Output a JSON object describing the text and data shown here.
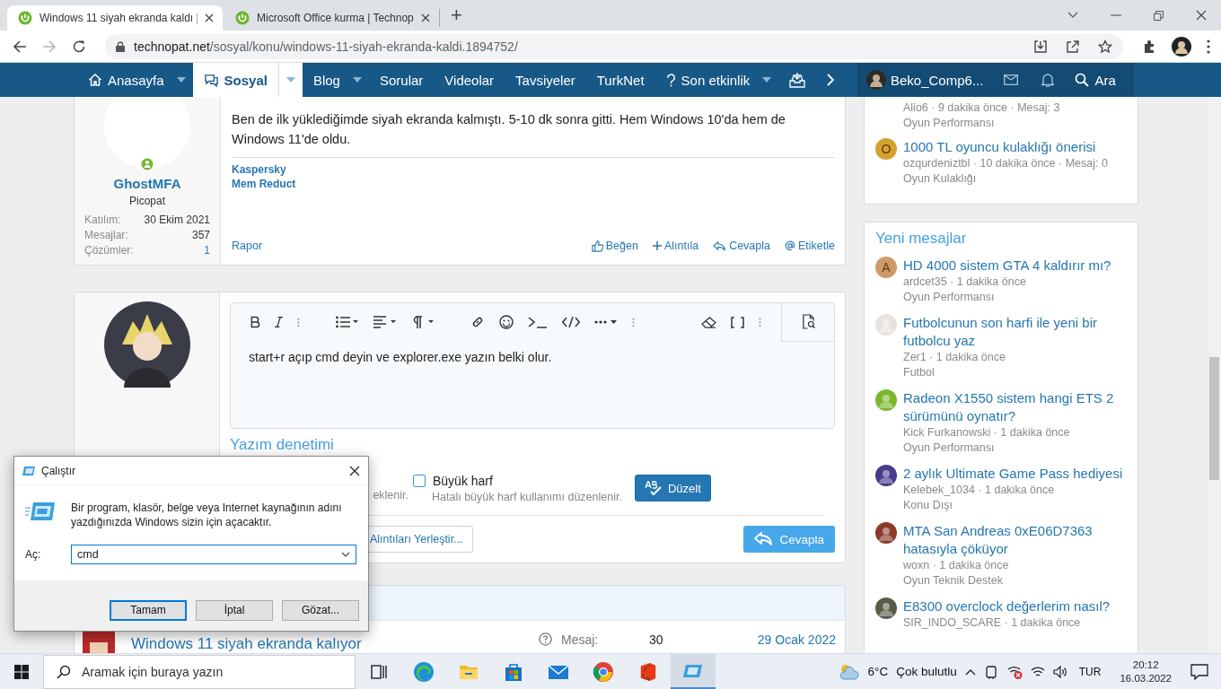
{
  "browser": {
    "tabs": [
      {
        "title": "Windows 11 siyah ekranda kaldı |",
        "selected": true
      },
      {
        "title": "Microsoft Office kurma | Technop",
        "selected": false
      }
    ],
    "new_tab": "+",
    "forward_disabled": true,
    "address": {
      "domain": "technopat.net",
      "path": "/sosyal/konu/windows-11-siyah-ekranda-kaldi.1894752/"
    }
  },
  "nav": {
    "items": [
      {
        "label": "Anasayfa",
        "dropdown": true,
        "selected": false
      },
      {
        "label": "Sosyal",
        "dropdown": true,
        "selected": true
      },
      {
        "label": "Blog",
        "dropdown": true,
        "selected": false
      },
      {
        "label": "Sorular",
        "dropdown": false,
        "selected": false
      },
      {
        "label": "Videolar",
        "dropdown": false,
        "selected": false
      },
      {
        "label": "Tavsiyeler",
        "dropdown": false,
        "selected": false
      },
      {
        "label": "TurkNet",
        "dropdown": false,
        "selected": false
      },
      {
        "label": "Son etkinlik",
        "dropdown": true,
        "selected": false
      }
    ],
    "user": "Beko_Comp6...",
    "search": "Ara"
  },
  "post": {
    "author": {
      "name": "GhostMFA",
      "online": true,
      "title": "Picopat",
      "stats": [
        {
          "label": "Katılım:",
          "value": "30 Ekim 2021"
        },
        {
          "label": "Mesajlar:",
          "value": "357"
        },
        {
          "label": "Çözümler:",
          "value": "1"
        }
      ]
    },
    "text": "Ben de ilk yüklediğimde siyah ekranda kalmıştı. 5-10 dk sonra gitti. Hem Windows 10'da hem de Windows 11'de oldu.",
    "signature": [
      "Kaspersky",
      "Mem Reduct"
    ],
    "report": "Rapor",
    "actions": [
      "Beğen",
      "Alıntıla",
      "Cevapla",
      "Etiketle"
    ]
  },
  "reply": {
    "text": "start+r açıp cmd deyin ve explorer.exe yazın belki olur.",
    "spellcheck": {
      "title": "Yazım denetimi",
      "options": [
        {
          "description": "eklenir."
        },
        {
          "label": "Büyük harf",
          "checked": false,
          "description": "Hatalı büyük harf kullanımı düzenlenir."
        }
      ],
      "fix_button": "Düzelt"
    },
    "insert_quotes": "Alıntıları Yerleştir...",
    "submit": "Cevapla"
  },
  "thread_row": {
    "title": "Windows 11 siyah ekranda kalıyor",
    "label": "Mesaj:",
    "count": "30",
    "date": "29 Ocak 2022"
  },
  "sidebar": {
    "top_items": [
      {
        "meta": "Alio6 · 9 dakika önce · Mesaj: 3",
        "category": "Oyun Performansı"
      },
      {
        "title": "1000 TL oyuncu kulaklığı önerisi",
        "meta": "ozqurdeniztbl · 10 dakika önce · Mesaj: 0",
        "category": "Oyun Kulaklığı",
        "avatar": {
          "kind": "letter",
          "letter": "O",
          "color": "#d4a22f"
        }
      }
    ],
    "new_messages": {
      "title": "Yeni mesajlar",
      "items": [
        {
          "title": "HD 4000 sistem GTA 4 kaldırır mı?",
          "meta": "ardcet35 · 1 dakika önce",
          "category": "Oyun Performansı",
          "avatar": {
            "kind": "letter",
            "letter": "A",
            "color": "#cf9a6a"
          }
        },
        {
          "title": "Futbolcunun son harfi ile yeni bir futbolcu yaz",
          "meta": "Zer1 · 1 dakika önce",
          "category": "Futbol",
          "avatar": {
            "kind": "image",
            "color": "#e6e2de"
          }
        },
        {
          "title": "Radeon X1550 sistem hangi ETS 2 sürümünü oynatır?",
          "meta": "Kick Furkanowski · 1 dakika önce",
          "category": "Oyun Performansı",
          "avatar": {
            "kind": "image",
            "color": "#7cb82f"
          }
        },
        {
          "title": "2 aylık Ultimate Game Pass hediyesi",
          "meta": "Kelebek_1034 · 1 dakika önce",
          "category": "Konu Dışı",
          "avatar": {
            "kind": "image",
            "color": "#4a3a8c"
          }
        },
        {
          "title": "MTA San Andreas 0xE06D7363 hatasıyla çöküyor",
          "meta": "woxn · 1 dakika önce",
          "category": "Oyun Teknik Destek",
          "avatar": {
            "kind": "image",
            "color": "#8a3a2a"
          }
        },
        {
          "title": "E8300 overclock değerlerim nasıl?",
          "meta": "SIR_INDO_SCARE · 1 dakika önce",
          "avatar": {
            "kind": "image",
            "color": "#5a5a4a"
          }
        }
      ]
    }
  },
  "run_dialog": {
    "title": "Çalıştır",
    "message": "Bir program, klasör, belge veya Internet kaynağının adını yazdığınızda Windows sizin için açacaktır.",
    "open_label": "Aç:",
    "value": "cmd",
    "buttons": [
      {
        "label": "Tamam",
        "default": true
      },
      {
        "label": "İptal",
        "default": false
      },
      {
        "label": "Gözat...",
        "default": false
      }
    ]
  },
  "taskbar": {
    "search_placeholder": "Aramak için buraya yazın",
    "apps": [
      {
        "active": false
      },
      {
        "active": false
      },
      {
        "active": false
      },
      {
        "active": false
      },
      {
        "active": false
      },
      {
        "active": false
      },
      {
        "active": false
      },
      {
        "active": true
      }
    ],
    "weather": {
      "temp": "6°C",
      "condition": "Çok bulutlu"
    },
    "language": "TUR",
    "time": "20:12",
    "date": "16.03.2022"
  }
}
